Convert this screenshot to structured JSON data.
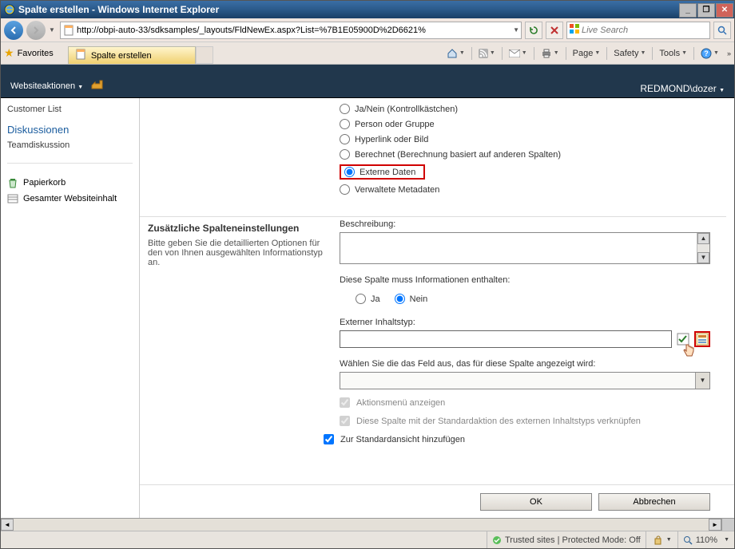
{
  "window": {
    "title": "Spalte erstellen - Windows Internet Explorer"
  },
  "address": {
    "url": "http://obpi-auto-33/sdksamples/_layouts/FldNewEx.aspx?List=%7B1E05900D%2D6621%"
  },
  "search": {
    "placeholder": "Live Search"
  },
  "favorites": {
    "label": "Favorites",
    "tab": "Spalte erstellen"
  },
  "commands": {
    "page": "Page",
    "safety": "Safety",
    "tools": "Tools"
  },
  "ribbon": {
    "siteactions": "Websiteaktionen",
    "user": "REDMOND\\dozer"
  },
  "leftnav": {
    "customerlist": "Customer List",
    "diskussionen": "Diskussionen",
    "teamdiskussion": "Teamdiskussion",
    "papierkorb": "Papierkorb",
    "gesamter": "Gesamter Websiteinhalt"
  },
  "settings": {
    "heading": "Zusätzliche Spalteneinstellungen",
    "desc": "Bitte geben Sie die detaillierten Optionen für den von Ihnen ausgewählten Informationstyp an."
  },
  "radios": {
    "janein": "Ja/Nein (Kontrollkästchen)",
    "person": "Person oder Gruppe",
    "hyperlink": "Hyperlink oder Bild",
    "berechnet": "Berechnet (Berechnung basiert auf anderen Spalten)",
    "extern": "Externe Daten",
    "metadaten": "Verwaltete Metadaten"
  },
  "form": {
    "beschreibung": "Beschreibung:",
    "must_contain": "Diese Spalte muss Informationen enthalten:",
    "ja": "Ja",
    "nein": "Nein",
    "ext_type": "Externer Inhaltstyp:",
    "select_field": "Wählen Sie die das Feld aus, das für diese Spalte angezeigt wird:",
    "actionsmenu": "Aktionsmenü anzeigen",
    "link_default": "Diese Spalte mit der Standardaktion des externen Inhaltstyps verknüpfen",
    "add_default_view": "Zur Standardansicht hinzufügen"
  },
  "buttons": {
    "ok": "OK",
    "cancel": "Abbrechen"
  },
  "status": {
    "trusted": "Trusted sites | Protected Mode: Off",
    "zoom": "110%"
  }
}
